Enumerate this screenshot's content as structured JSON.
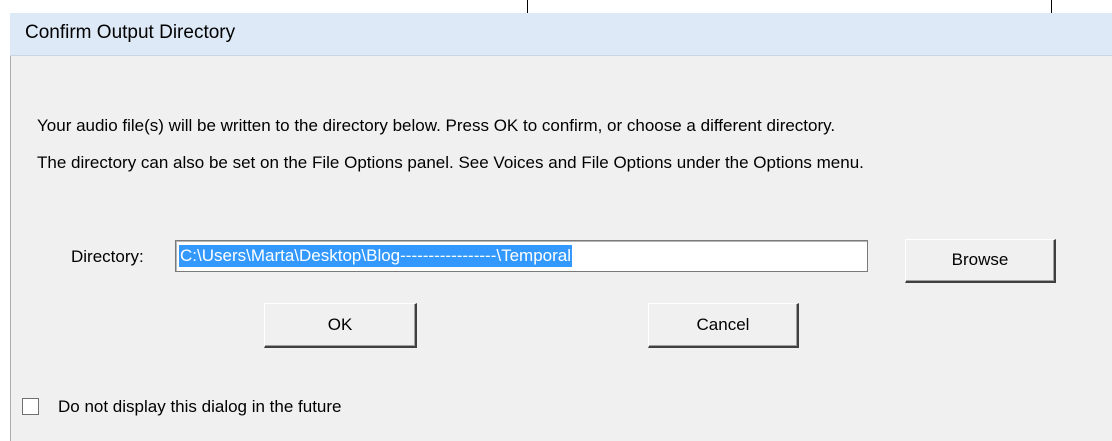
{
  "window": {
    "title": "Confirm Output Directory"
  },
  "message": {
    "line1": "Your audio file(s) will be written to the directory  below.  Press OK to confirm,  or choose a different directory.",
    "line2": "The directory can also be set on the File Options panel.  See Voices and File Options under the Options menu."
  },
  "directory": {
    "label": "Directory:",
    "value": "C:\\Users\\Marta\\Desktop\\Blog-----------------\\Temporal"
  },
  "buttons": {
    "browse": "Browse",
    "ok": "OK",
    "cancel": "Cancel"
  },
  "checkbox": {
    "label": "Do not display this dialog in the future",
    "checked": false
  },
  "colors": {
    "titlebar": "#dde9f6",
    "selection": "#3399ff",
    "dialog_bg": "#f0f0f0"
  }
}
